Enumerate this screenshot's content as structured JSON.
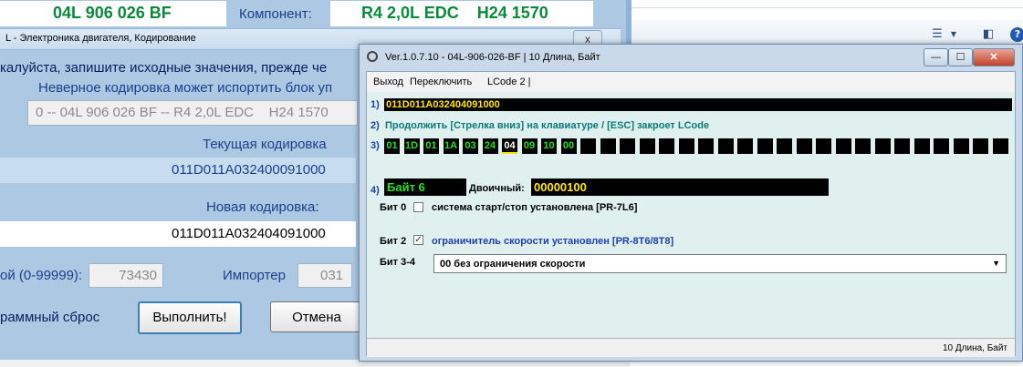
{
  "explorer": {
    "view_icon": "☰",
    "view_arrow": "▼",
    "pane_icon": "◧",
    "help_icon": "?"
  },
  "coding_window": {
    "part_number": "04L 906 026 BF",
    "component_label": "Компонент:",
    "component_value": "R4 2,0L EDC    H24 1570",
    "caption": "L - Электроника двигателя,  Кодирование",
    "caption_close": "x",
    "warning_line1": "калуйста, запишите исходные значения, прежде че",
    "warning_line2": "Неверное кодировка может испортить блок уп",
    "ecu_select": "0 -- 04L 906 026 BF -- R4 2,0L EDC    H24 1570",
    "current_coding_label": "Текущая кодировка",
    "current_coding_value": "011D011A032400091000",
    "new_coding_label": "Новая кодировка:",
    "new_coding_value": "011D011A032404091000",
    "shop_label": "ой (0-99999):",
    "shop_value": "73430",
    "importer_label": "Импортер",
    "importer_value": "031",
    "reset_label": "раммный сброс",
    "execute_button": "Выполнить!",
    "cancel_button": "Отмена"
  },
  "lcode_window": {
    "title": "Ver.1.0.7.10 -   04L-906-026-BF | 10 Длина, Байт",
    "btn_min": "—",
    "btn_max": "☐",
    "btn_close": "✕",
    "menu": [
      "Выход",
      "Переключить",
      "LCode 2 |"
    ],
    "row1_num": "1)",
    "coding_string": "011D011A032404091000",
    "row2_num": "2)",
    "hint": "Продолжить [Стрелка вниз] на клавиатуре / [ESC] закроет LCode",
    "row3_num": "3)",
    "bytes": [
      "01",
      "1D",
      "01",
      "1A",
      "03",
      "24",
      "04",
      "09",
      "10",
      "00",
      "",
      "",
      "",
      "",
      "",
      "",
      "",
      "",
      "",
      "",
      "",
      "",
      "",
      "",
      "",
      "",
      "",
      "",
      "",
      "",
      "",
      ""
    ],
    "selected_byte_index": 6,
    "row4_num": "4)",
    "byte_label": "Байт 6",
    "binary_label": "Двоичный:",
    "binary_value": "00000100",
    "bit0_label": "Бит 0",
    "bit0_checked": false,
    "bit0_text": "система старт/стоп установлена [PR-7L6]",
    "bit2_label": "Бит 2",
    "bit2_checked": true,
    "bit2_mark": "✓",
    "bit2_text": "ограничитель скорости установлен [PR-8T6/8T8]",
    "bit34_label": "Бит 3-4",
    "bit34_value": "00 без ограничения скорости",
    "bit34_arrow": "▼",
    "status_text": "10 Длина, Байт"
  },
  "colors": {
    "coding_bg": "#acc8e2",
    "part_green": "#0a8a3c",
    "label_blue": "#1c3f8c",
    "byte_green": "#20e020",
    "coding_yellow": "#ffe600",
    "hint_teal": "#0a7a7a"
  }
}
